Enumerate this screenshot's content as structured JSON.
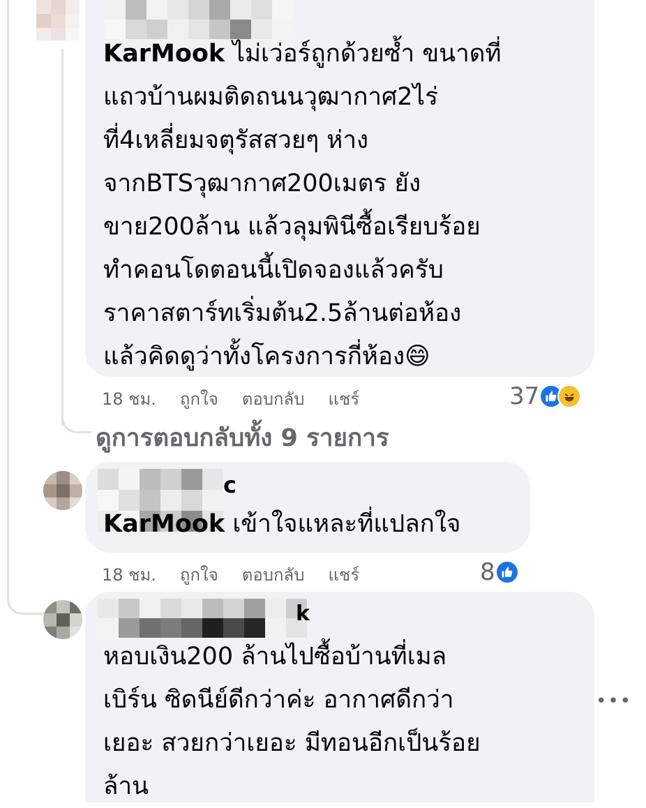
{
  "comments": [
    {
      "author_visible": "lnnfi",
      "mention_visible": "KarMook",
      "text": "ไม่เว่อร์ถูกด้วยซ้ำ ขนาดที่\nแถวบ้านผมติดถนนวุฒากาศ2ไร่\nที่4เหลี่ยมจตุรัสสวยๆ ห่าง\nจากBTSวุฒากาศ200เมตร ยัง\nขาย200ล้าน แล้วลุมพินีซื้อเรียบร้อย\nทำคอนโดตอนนี้เปิดจองแล้วครับ\nราคาสตาร์ทเริ่มต้น2.5ล้านต่อห้อง\nแล้วคิดดูว่าทั้งโครงการกี่ห้อง😄",
      "time": "18 ชม.",
      "like": "ถูกใจ",
      "reply": "ตอบกลับ",
      "share": "แชร์",
      "reaction_count": "37",
      "reaction_icons": [
        "like-icon",
        "haha-icon"
      ]
    },
    {
      "author_visible": "c",
      "mention_visible": "KarMook",
      "text": "เข้าใจแหละที่แปลกใจ",
      "time": "18 ชม.",
      "like": "ถูกใจ",
      "reply": "ตอบกลับ",
      "share": "แชร์",
      "reaction_count": "8",
      "reaction_icons": [
        "like-icon"
      ]
    },
    {
      "author_visible": "k",
      "text": "หอบเงิน200 ล้านไปซื้อบ้านที่เมล\nเบิร์น ซิดนีย์ดีกว่าค่ะ อากาศดีกว่า\nเยอะ สวยกว่าเยอะ มีทอนอีกเป็นร้อย\nล้าน"
    }
  ],
  "view_replies": "ดูการตอบกลับทั้ง 9 รายการ",
  "colors": {
    "bubble": "#f0f2f5",
    "meta_text": "#65676b",
    "like_blue": "#1b74e4",
    "haha_yellow": "#f7c02a"
  }
}
